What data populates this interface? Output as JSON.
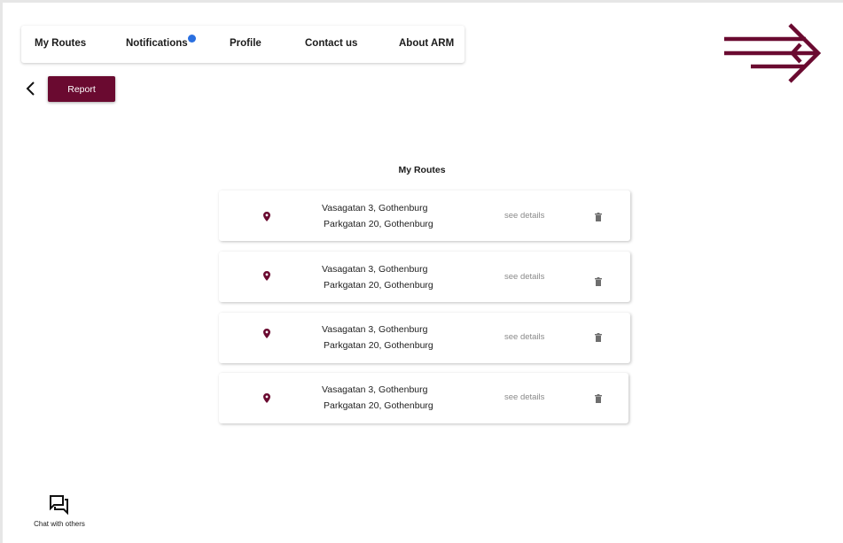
{
  "nav": {
    "items": [
      {
        "label": "My Routes"
      },
      {
        "label": "Notifications",
        "has_badge": true
      },
      {
        "label": "Profile"
      },
      {
        "label": "Contact us"
      },
      {
        "label": "About ARM"
      }
    ]
  },
  "toolbar": {
    "back_icon": "chevron-left-icon",
    "report_label": "Report"
  },
  "logo": {
    "icon": "triple-arrow-right-icon"
  },
  "main": {
    "title": "My Routes",
    "routes": [
      {
        "from": "Vasagatan 3, Gothenburg",
        "to": "Parkgatan 20, Gothenburg",
        "details_label": "see details"
      },
      {
        "from": "Vasagatan 3, Gothenburg",
        "to": "Parkgatan 20, Gothenburg",
        "details_label": "see details"
      },
      {
        "from": "Vasagatan 3, Gothenburg",
        "to": "Parkgatan 20, Gothenburg",
        "details_label": "see details"
      },
      {
        "from": "Vasagatan 3, Gothenburg",
        "to": "Parkgatan 20, Gothenburg",
        "details_label": "see details"
      }
    ]
  },
  "chat": {
    "label": "Chat with others",
    "icon": "forum-icon"
  },
  "colors": {
    "brand": "#6a0a30",
    "badge": "#2a6fe0",
    "muted": "#8a8a8a"
  }
}
